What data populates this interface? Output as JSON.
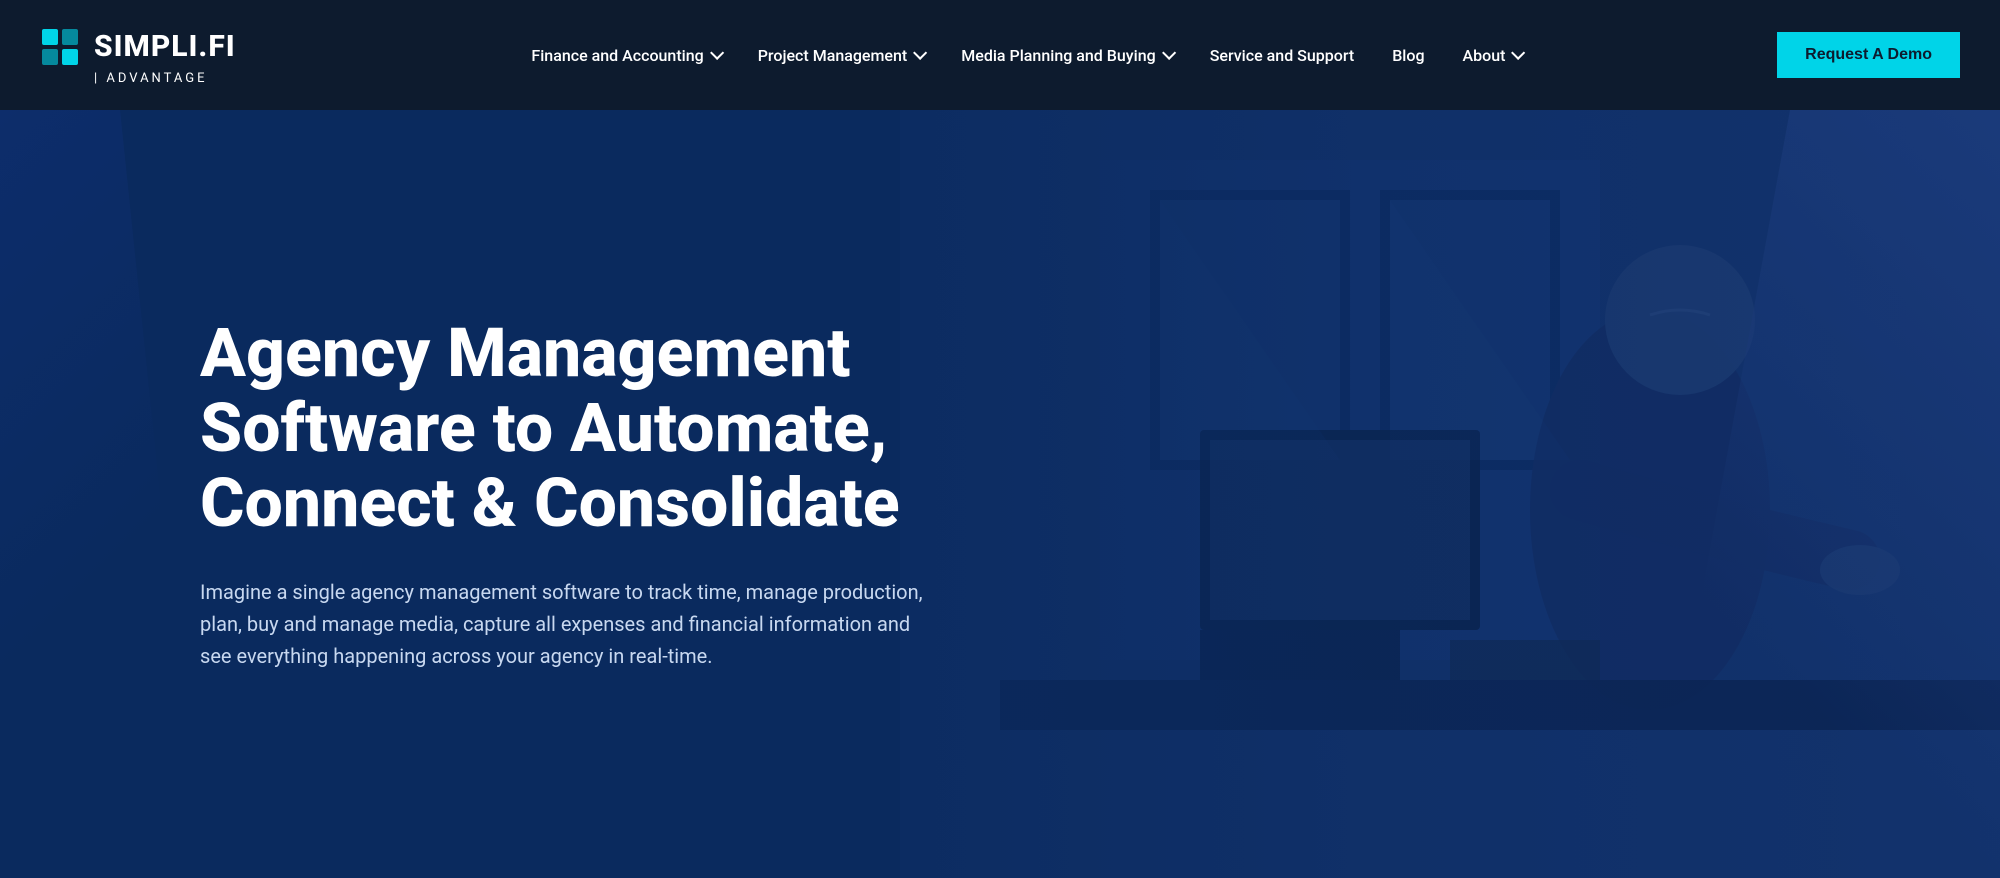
{
  "logo": {
    "text": "SIMPLI.FI",
    "sub": "| ADVANTAGE"
  },
  "nav": {
    "items": [
      {
        "label": "Finance and Accounting",
        "has_dropdown": true
      },
      {
        "label": "Project Management",
        "has_dropdown": true
      },
      {
        "label": "Media Planning and Buying",
        "has_dropdown": true
      },
      {
        "label": "Service and Support",
        "has_dropdown": false
      },
      {
        "label": "Blog",
        "has_dropdown": false
      },
      {
        "label": "About",
        "has_dropdown": true
      }
    ],
    "cta_label": "Request A Demo"
  },
  "hero": {
    "heading": "Agency Management Software to Automate, Connect & Consolidate",
    "subtext": "Imagine a single agency management software to track time, manage production, plan, buy and manage media, capture all expenses and financial information and see everything happening across your agency in real-time."
  },
  "colors": {
    "nav_bg": "#0d1b2e",
    "cta_bg": "#00d4e8",
    "hero_bg": "#0a2a5e"
  }
}
